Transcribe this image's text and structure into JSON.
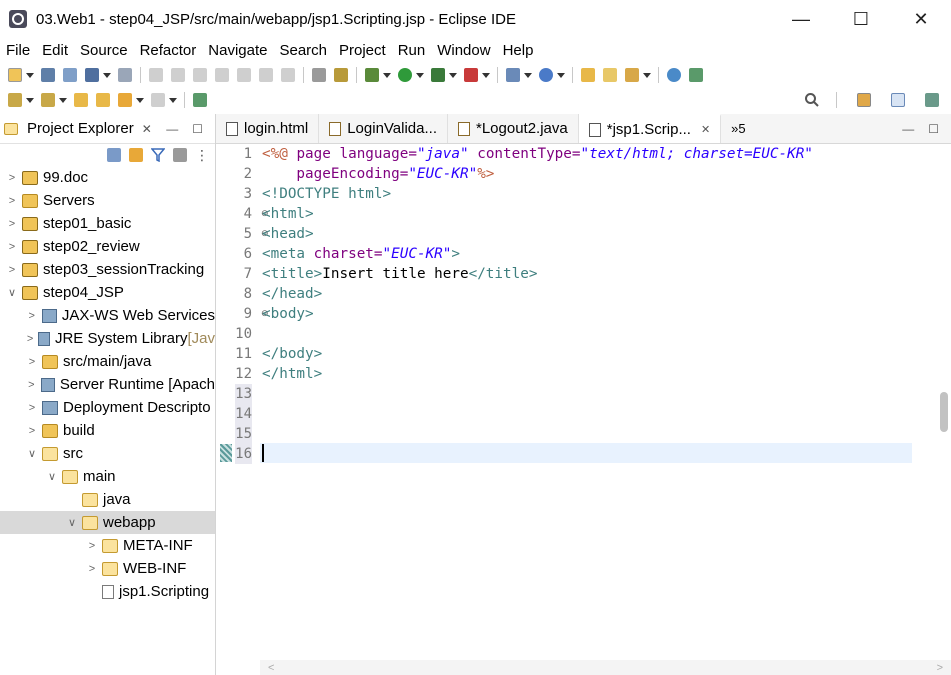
{
  "window": {
    "title": "03.Web1 - step04_JSP/src/main/webapp/jsp1.Scripting.jsp - Eclipse IDE",
    "minimize": "—",
    "maximize": "☐",
    "close": "✕"
  },
  "menu": [
    "File",
    "Edit",
    "Source",
    "Refactor",
    "Navigate",
    "Search",
    "Project",
    "Run",
    "Window",
    "Help"
  ],
  "left_panel": {
    "title": "Project Explorer",
    "close": "✕",
    "min": "—",
    "max": "☐",
    "tree": [
      {
        "label": "99.doc",
        "tail": ""
      },
      {
        "label": "Servers",
        "tail": ""
      },
      {
        "label": "step01_basic",
        "tail": ""
      },
      {
        "label": "step02_review",
        "tail": ""
      },
      {
        "label": "step03_sessionTracking",
        "tail": ""
      },
      {
        "label": "step04_JSP",
        "tail": ""
      },
      {
        "label": "JAX-WS Web Services",
        "tail": ""
      },
      {
        "label": "JRE System Library ",
        "tail": "[Jav"
      },
      {
        "label": "src/main/java",
        "tail": ""
      },
      {
        "label": "Server Runtime [Apach",
        "tail": ""
      },
      {
        "label": "Deployment Descripto",
        "tail": ""
      },
      {
        "label": "build",
        "tail": ""
      },
      {
        "label": "src",
        "tail": ""
      },
      {
        "label": "main",
        "tail": ""
      },
      {
        "label": "java",
        "tail": ""
      },
      {
        "label": "webapp",
        "tail": ""
      },
      {
        "label": "META-INF",
        "tail": ""
      },
      {
        "label": "WEB-INF",
        "tail": ""
      },
      {
        "label": "jsp1.Scripting",
        "tail": ""
      }
    ]
  },
  "editor_tabs": [
    {
      "label": "login.html"
    },
    {
      "label": "LoginValida..."
    },
    {
      "label": "*Logout2.java"
    },
    {
      "label": "*jsp1.Scrip..."
    }
  ],
  "editor_tab_close": "✕",
  "more_tabs": "»5",
  "line_numbers": [
    "1",
    "2",
    "3",
    "4",
    "5",
    "6",
    "7",
    "8",
    "9",
    "10",
    "11",
    "12",
    "13",
    "14",
    "15",
    "16"
  ],
  "code": {
    "l1": [
      "<%@ ",
      "page ",
      "language=",
      "\"java\"",
      " contentType=",
      "\"text/html; charset=EUC-KR\""
    ],
    "l2": [
      "    pageEncoding=",
      "\"EUC-KR\"",
      "%>"
    ],
    "l3": [
      "<!DOCTYPE html>"
    ],
    "l4": [
      "<html>"
    ],
    "l5": [
      "<head>"
    ],
    "l6": [
      "<meta ",
      "charset=",
      "\"EUC-KR\"",
      ">"
    ],
    "l7": [
      "<title>",
      "Insert title here",
      "</title>"
    ],
    "l8": [
      "</head>"
    ],
    "l9": [
      "<body>"
    ],
    "l11": [
      "</body>"
    ],
    "l12": [
      "</html>"
    ]
  },
  "scroll": {
    "left": "<",
    "right": ">"
  }
}
